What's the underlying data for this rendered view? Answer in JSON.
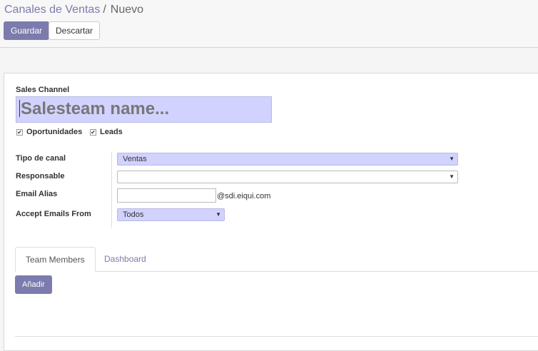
{
  "breadcrumb": {
    "parent": "Canales de Ventas",
    "separator": "/",
    "current": "Nuevo"
  },
  "toolbar": {
    "save_label": "Guardar",
    "discard_label": "Descartar"
  },
  "form": {
    "name_label": "Sales Channel",
    "name_placeholder": "Salesteam name...",
    "checkboxes": [
      {
        "label": "Oportunidades",
        "checked": true
      },
      {
        "label": "Leads",
        "checked": true
      }
    ],
    "fields": {
      "channel_type": {
        "label": "Tipo de canal",
        "value": "Ventas"
      },
      "responsible": {
        "label": "Responsable",
        "value": ""
      },
      "email_alias": {
        "label": "Email Alias",
        "value": "",
        "domain": "@sdi.eiqui.com"
      },
      "accept_emails": {
        "label": "Accept Emails From",
        "value": "Todos"
      }
    }
  },
  "tabs": [
    {
      "label": "Team Members",
      "active": true
    },
    {
      "label": "Dashboard",
      "active": false
    }
  ],
  "members": {
    "add_label": "Añadir"
  },
  "icons": {
    "checkmark": "✔",
    "dropdown": "▼"
  },
  "colors": {
    "primary": "#7c7bad",
    "required_field": "#d2d2ff"
  }
}
